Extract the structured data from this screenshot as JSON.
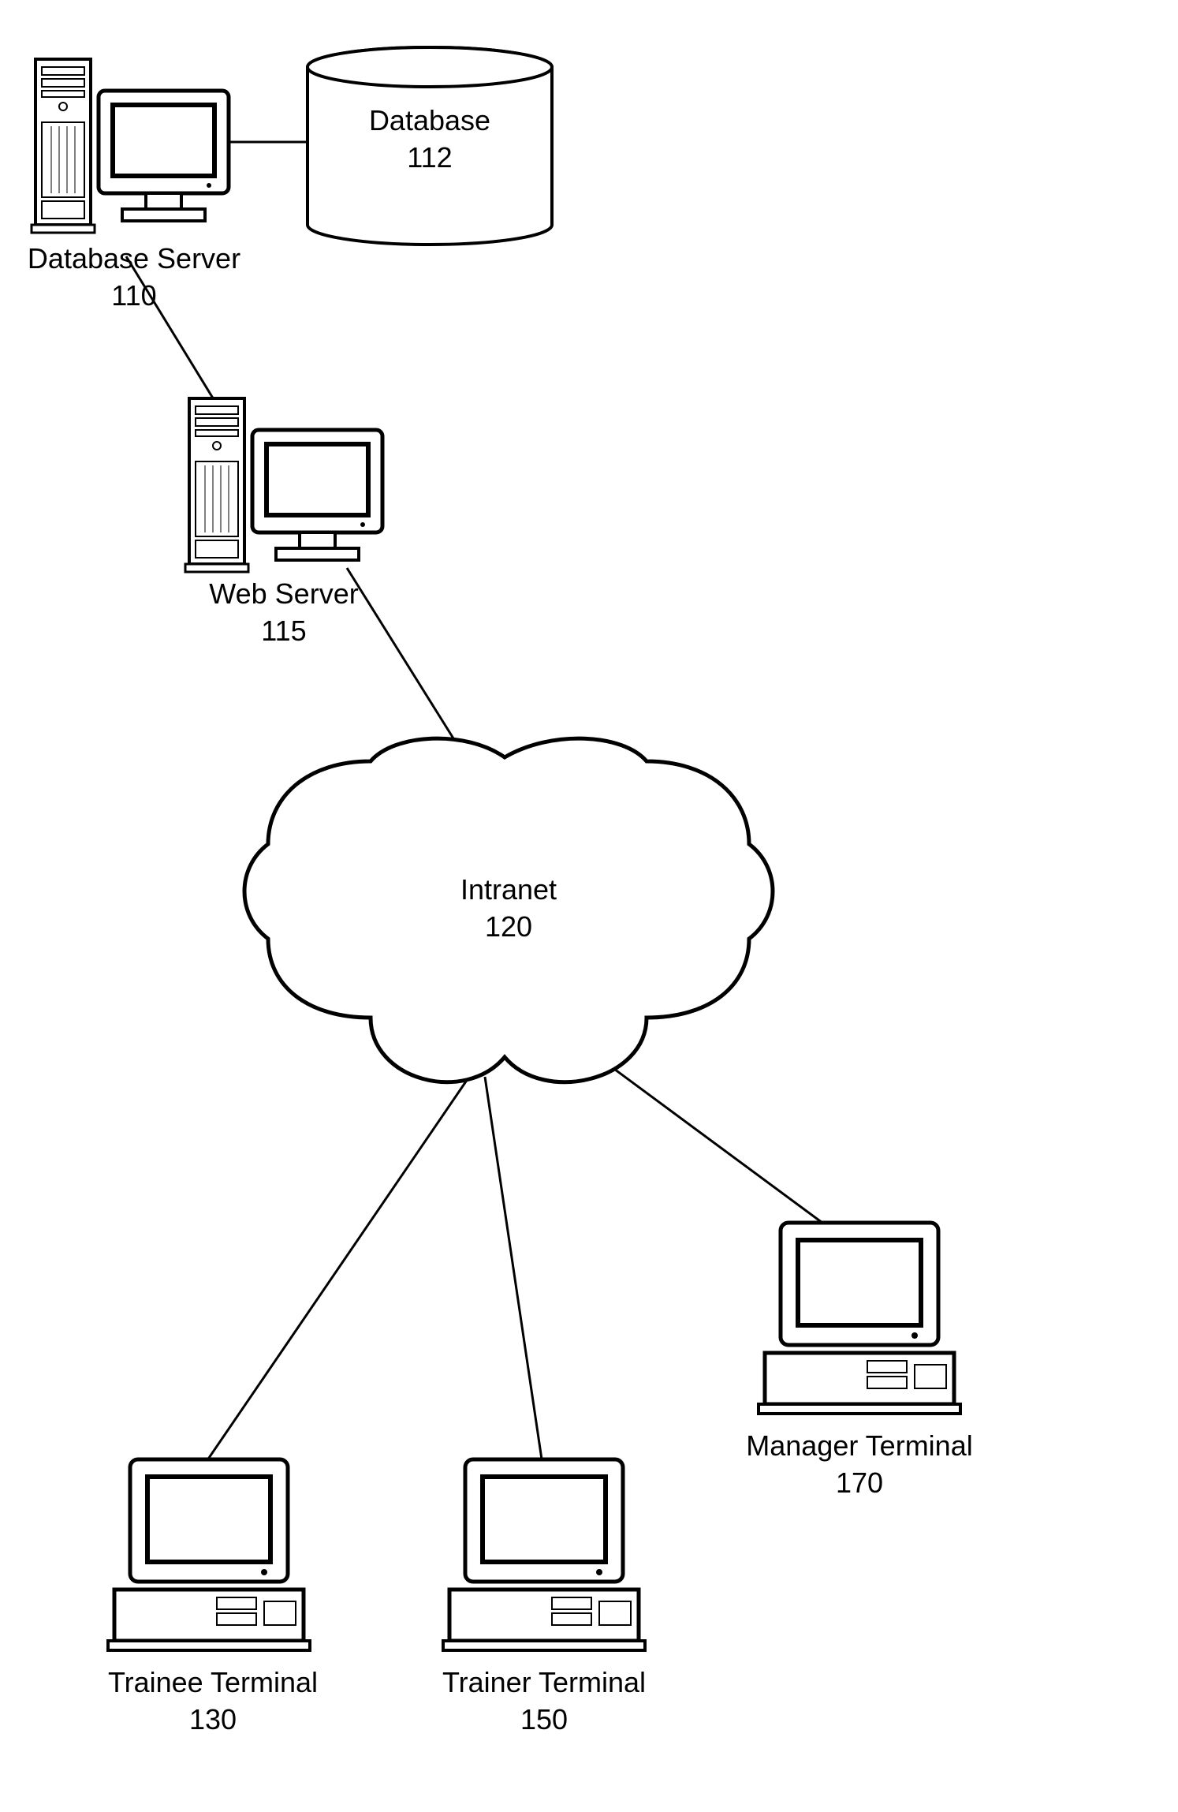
{
  "diagram": {
    "nodes": {
      "databaseServer": {
        "label": "Database Server",
        "ref": "110"
      },
      "database": {
        "label": "Database",
        "ref": "112"
      },
      "webServer": {
        "label": "Web Server",
        "ref": "115"
      },
      "intranet": {
        "label": "Intranet",
        "ref": "120"
      },
      "traineeTerminal": {
        "label": "Trainee Terminal",
        "ref": "130"
      },
      "trainerTerminal": {
        "label": "Trainer Terminal",
        "ref": "150"
      },
      "managerTerminal": {
        "label": "Manager Terminal",
        "ref": "170"
      }
    }
  }
}
